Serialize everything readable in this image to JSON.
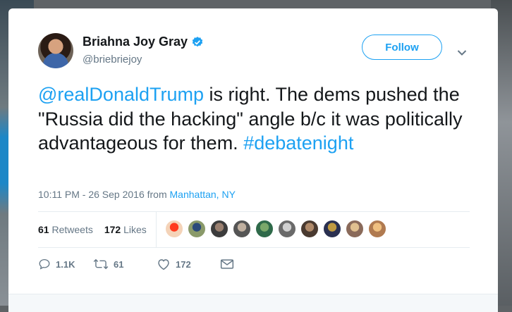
{
  "author": {
    "name": "Briahna Joy Gray",
    "handle": "@briebriejoy"
  },
  "follow_label": "Follow",
  "tweet": {
    "mention": "@realDonaldTrump",
    "body": " is right. The dems pushed the \"Russia did the hacking\" angle b/c it was politically advantageous for them. ",
    "hashtag": "#debatenight"
  },
  "meta": {
    "timestamp": "10:11 PM - 26 Sep 2016",
    "from_label": "from",
    "location": "Manhattan, NY"
  },
  "stats": {
    "retweets_count": "61",
    "retweets_label": "Retweets",
    "likes_count": "172",
    "likes_label": "Likes"
  },
  "likers": [
    {
      "color": "#f4d3b8",
      "accent": "#ff3b1f"
    },
    {
      "color": "#8a9a6a",
      "accent": "#2b4a7a"
    },
    {
      "color": "#3c3c3c",
      "accent": "#9a8070"
    },
    {
      "color": "#555555",
      "accent": "#c0b0a0"
    },
    {
      "color": "#2f6a4a",
      "accent": "#7aa86a"
    },
    {
      "color": "#6a6a6a",
      "accent": "#d0d0d0"
    },
    {
      "color": "#4a3a30",
      "accent": "#b08a6a"
    },
    {
      "color": "#2a3050",
      "accent": "#c09a40"
    },
    {
      "color": "#8a6a5a",
      "accent": "#e0c090"
    },
    {
      "color": "#b07a50",
      "accent": "#f0c080"
    }
  ],
  "actions": {
    "reply_count": "1.1K",
    "retweet_count": "61",
    "like_count": "172"
  },
  "colors": {
    "accent": "#1da1f2",
    "text": "#14171a",
    "muted": "#657786"
  }
}
